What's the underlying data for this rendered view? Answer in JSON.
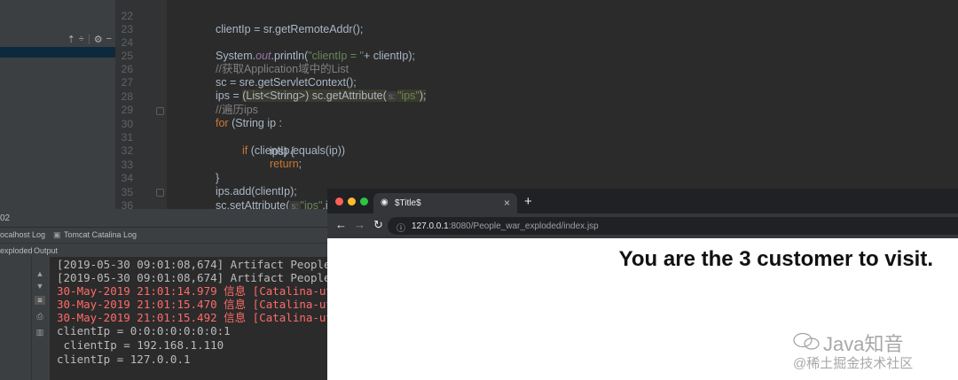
{
  "editor": {
    "lines": [
      {
        "num": "22"
      },
      {
        "num": "23"
      },
      {
        "num": "24"
      },
      {
        "num": "25"
      },
      {
        "num": "26"
      },
      {
        "num": "27"
      },
      {
        "num": "28"
      },
      {
        "num": "29"
      },
      {
        "num": "30"
      },
      {
        "num": "31"
      },
      {
        "num": "32"
      },
      {
        "num": "33"
      },
      {
        "num": "34"
      },
      {
        "num": "35"
      },
      {
        "num": "36"
      }
    ],
    "tokens": {
      "l22": "clientIp = sr.getRemoteAddr();",
      "l24a": "System.",
      "l24b": "out",
      "l24c": ".println(",
      "l24d": "\"clientIp = \"",
      "l24e": "+ clientIp);",
      "l25": "//获取Application域中的List",
      "l26": "sc = sre.getServletContext();",
      "l27a": "ips = ",
      "l27b": "(List<String>) sc.getAttribute(",
      "l27hint": "s:",
      "l27c": "\"ips\"",
      "l27d": ");",
      "l28": "//遍历ips",
      "l29a": "for",
      "l29b": " (String ip :",
      "l30": "ips) {",
      "l31a": "if",
      "l31b": " (clientIp.equals(ip))",
      "l32a": "return",
      "l32b": ";",
      "l33": "}",
      "l34": "ips.add(clientIp);",
      "l35a": "sc.setAttribute(",
      "l35hint": "s:",
      "l35b": "\"ips\"",
      "l35c": ",ips);",
      "l36": "}"
    }
  },
  "run_panel": {
    "header_num": "02",
    "tab1": "ocalhost Log",
    "tab2": "Tomcat Catalina Log",
    "sub_left": "exploded",
    "sub_output": "Output",
    "console_lines": [
      {
        "text": "[2019-05-30 09:01:08,674] Artifact People",
        "color": "gray"
      },
      {
        "text": "[2019-05-30 09:01:08,674] Artifact People",
        "color": "gray"
      },
      {
        "text": "30-May-2019 21:01:14.979 信息 [Catalina-ut",
        "color": "red"
      },
      {
        "text": "30-May-2019 21:01:15.470 信息 [Catalina-ut",
        "color": "red"
      },
      {
        "text": "30-May-2019 21:01:15.492 信息 [Catalina-ut",
        "color": "red"
      },
      {
        "text": "clientIp = 0:0:0:0:0:0:0:1",
        "color": "gray"
      },
      {
        "text": " clientIp = 192.168.1.110",
        "color": "gray"
      },
      {
        "text": "clientIp = 127.0.0.1",
        "color": "gray"
      }
    ]
  },
  "browser": {
    "tab_title": "$Title$",
    "url_host": "127.0.0.1",
    "url_rest": ":8080/People_war_exploded/index.jsp",
    "message": "You are the 3 customer to visit.",
    "colors": {
      "close": "#ff5f57",
      "minimize": "#febc2e",
      "maximize": "#28c840"
    }
  },
  "watermark": {
    "line1": "Java知音",
    "line2": "@稀土掘金技术社区"
  }
}
